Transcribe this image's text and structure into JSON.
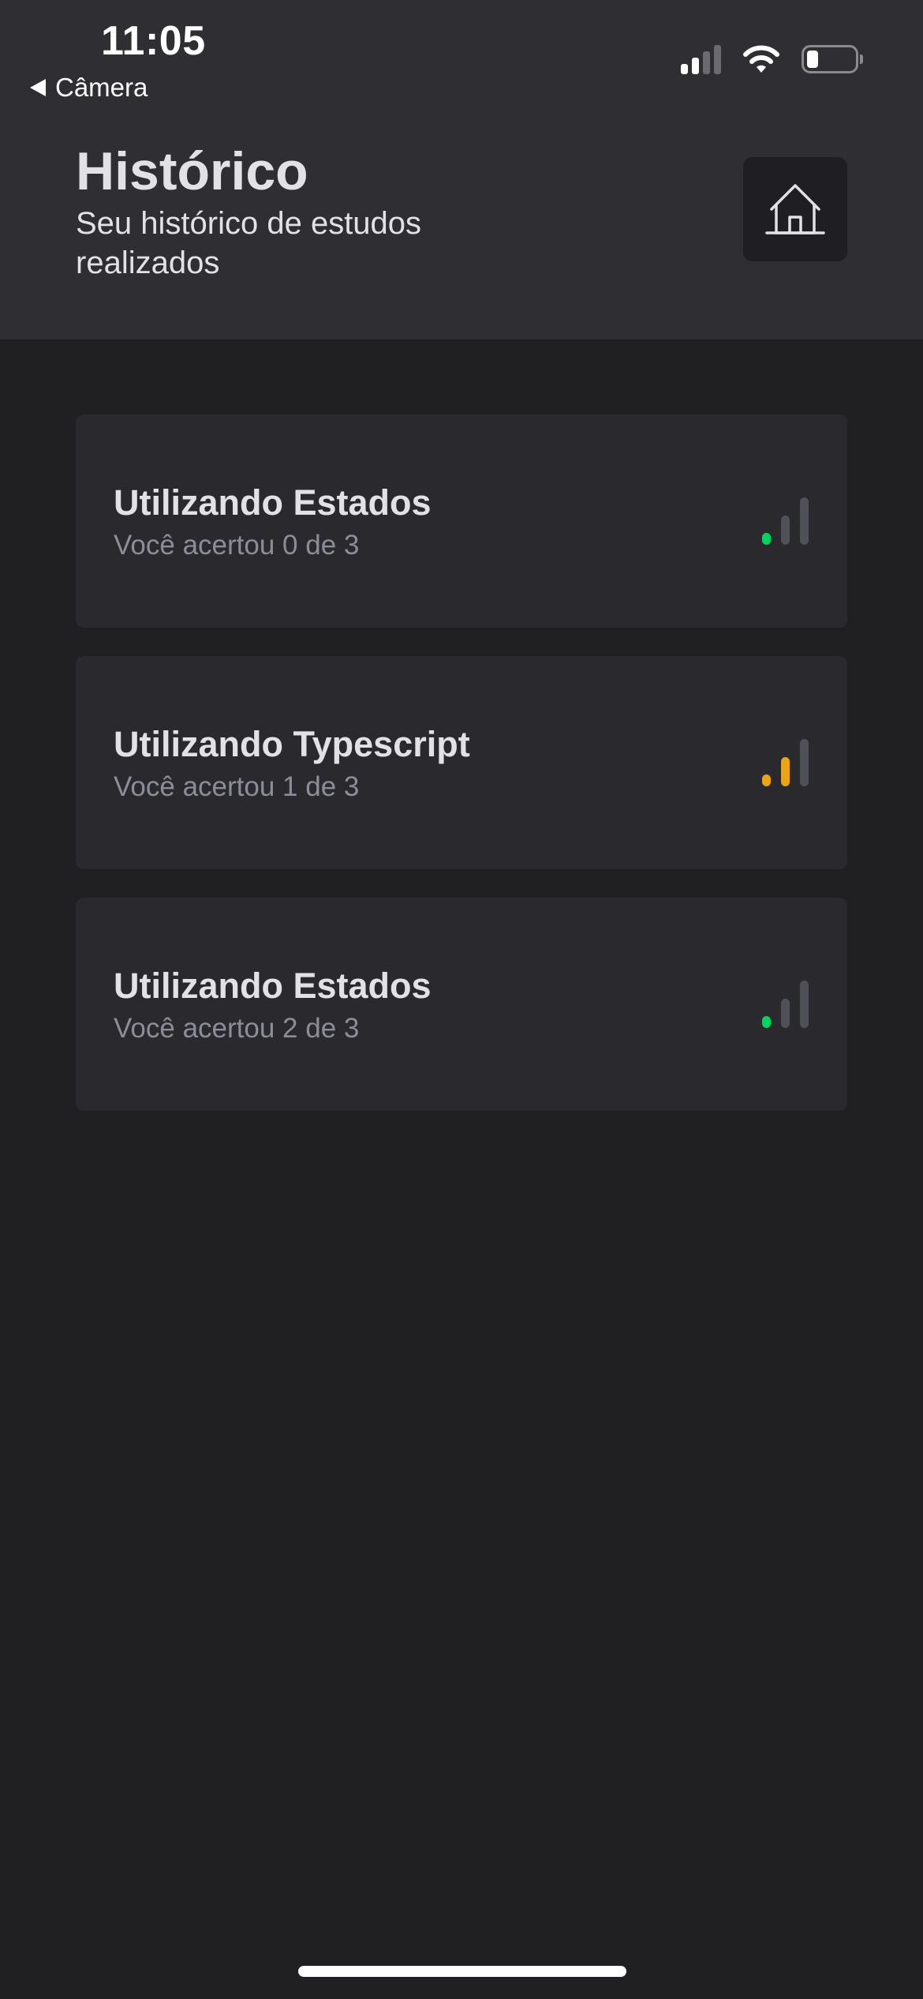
{
  "status_bar": {
    "time": "11:05",
    "back_label": "Câmera"
  },
  "header": {
    "title": "Histórico",
    "subtitle": "Seu histórico de estudos realizados",
    "home_icon": "home-icon"
  },
  "history": [
    {
      "title": "Utilizando Estados",
      "result": "Você acertou 0 de 3",
      "level_bars_lit": 1,
      "level_color": "#04d361"
    },
    {
      "title": "Utilizando Typescript",
      "result": "Você acertou 1 de 3",
      "level_bars_lit": 2,
      "level_color": "#eba417"
    },
    {
      "title": "Utilizando Estados",
      "result": "Você acertou 2 de 3",
      "level_bars_lit": 1,
      "level_color": "#04d361"
    }
  ],
  "colors": {
    "header_bg": "#2e2e33",
    "page_bg": "#202023",
    "card_bg": "#29292e",
    "green": "#04d361",
    "orange": "#eba417",
    "dim_bar": "#505059"
  }
}
